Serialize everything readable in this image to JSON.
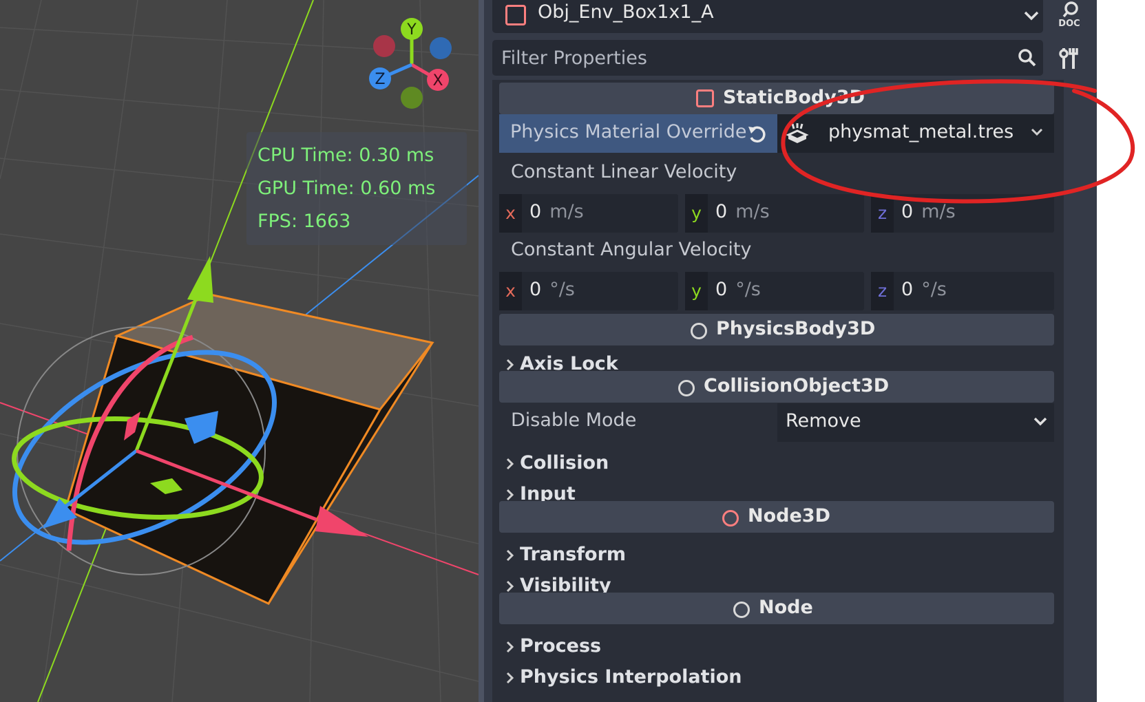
{
  "viewport": {
    "gizmo": {
      "y": "Y",
      "x": "X",
      "z": "Z"
    },
    "perf": {
      "cpu": "CPU Time: 0.30 ms",
      "gpu": "GPU Time: 0.60 ms",
      "fps": "FPS: 1663"
    }
  },
  "inspector": {
    "node_name": "Obj_Env_Box1x1_A",
    "doc_label": "DOC",
    "filter_placeholder": "Filter Properties",
    "sections": {
      "staticbody": "StaticBody3D",
      "physicsbody": "PhysicsBody3D",
      "collisionobject": "CollisionObject3D",
      "node3d": "Node3D",
      "node": "Node"
    },
    "properties": {
      "physics_material_override": {
        "label": "Physics Material Override",
        "value": "physmat_metal.tres"
      },
      "constant_linear_velocity": {
        "label": "Constant Linear Velocity",
        "unit": "m/s",
        "x": "0",
        "y": "0",
        "z": "0"
      },
      "constant_angular_velocity": {
        "label": "Constant Angular Velocity",
        "unit": "°/s",
        "x": "0",
        "y": "0",
        "z": "0"
      },
      "disable_mode": {
        "label": "Disable Mode",
        "value": "Remove"
      }
    },
    "axis_labels": {
      "x": "x",
      "y": "y",
      "z": "z"
    },
    "subgroups": {
      "axis_lock": "Axis Lock",
      "collision": "Collision",
      "input": "Input",
      "transform": "Transform",
      "visibility": "Visibility",
      "process": "Process",
      "physics_interp": "Physics Interpolation"
    }
  },
  "colors": {
    "node_icon": "#fc7f7f",
    "axis_x": "#f0456b",
    "axis_y": "#8dda1f",
    "axis_z": "#3b8eef",
    "selection": "#f08a24",
    "perf_text": "#7ef07a",
    "annotation": "#e02424"
  },
  "icons": {
    "node_type": "static-body-icon",
    "doc": "doc-search-icon",
    "filter": "search-icon",
    "tools": "tools-icon",
    "revert": "revert-icon",
    "resource": "physics-material-icon",
    "dropdown": "chevron-down-icon",
    "expand": "chevron-right-icon"
  }
}
